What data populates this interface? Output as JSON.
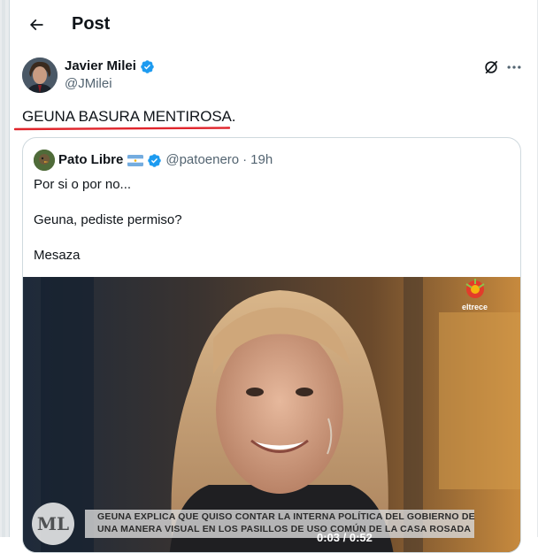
{
  "header": {
    "title": "Post"
  },
  "post": {
    "author_name": "Javier Milei",
    "author_handle": "@JMilei",
    "text": "GEUNA BASURA MENTIROSA."
  },
  "quote": {
    "author_name": "Pato Libre",
    "author_handle": "@patoenero",
    "separator": "·",
    "time": "19h",
    "lines": [
      "Por si o por no...",
      "Geuna, pediste permiso?",
      "Mesaza"
    ],
    "video": {
      "channel_label": "eltrece",
      "show_logo": "ML",
      "caption_line_1": "GEUNA EXPLICA QUE QUISO CONTAR LA INTERNA POLÍTICA DEL GOBIERNO DE",
      "caption_line_2": "UNA MANERA VISUAL EN LOS PASILLOS DE USO COMÚN DE LA CASA ROSADA",
      "time_display": "0:03 / 0:52"
    }
  },
  "colors": {
    "text_primary": "#0f1419",
    "text_secondary": "#536471",
    "verified_blue": "#1d9bf0",
    "border": "#cfd9de",
    "underline_red": "#e0242b"
  },
  "icons": {
    "back": "arrow-left-icon",
    "verified": "verified-badge-icon",
    "grok": "grok-icon",
    "more": "more-horizontal-icon"
  }
}
